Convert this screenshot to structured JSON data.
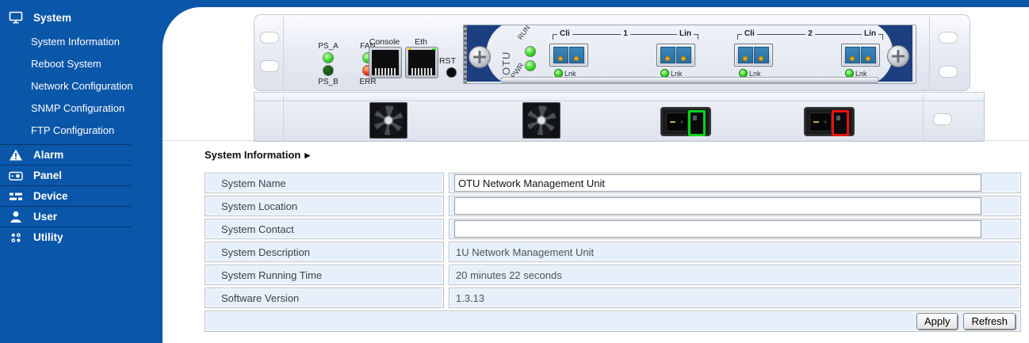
{
  "colors": {
    "sidebar_blue": "#0A56A8",
    "row_bg": "#E7F0FA",
    "power_ok_outline": "#00D41C",
    "power_err_outline": "#E81212",
    "led_green": "#2ED41E",
    "led_red": "#F02800"
  },
  "sidebar": {
    "sections": [
      {
        "label": "System",
        "icon": "monitor-icon"
      },
      {
        "label": "Alarm",
        "icon": "alarm-icon"
      },
      {
        "label": "Panel",
        "icon": "panel-icon"
      },
      {
        "label": "Device",
        "icon": "device-icon"
      },
      {
        "label": "User",
        "icon": "user-icon"
      },
      {
        "label": "Utility",
        "icon": "utility-icon"
      }
    ],
    "system_subitems": [
      "System Information",
      "Reboot System",
      "Network Configuration",
      "SNMP Configuration",
      "FTP Configuration"
    ]
  },
  "device": {
    "labels": {
      "ps_a": "PS_A",
      "fan": "FAN",
      "ps_b": "PS_B",
      "err": "ERR",
      "console": "Console",
      "eth": "Eth",
      "rst": "RST",
      "otu": "OTU",
      "run": "RUN",
      "pwr": "PWR",
      "lnk": "Lnk"
    },
    "groups": [
      {
        "cli": "Cli",
        "num": "1",
        "lin": "Lin"
      },
      {
        "cli": "Cli",
        "num": "2",
        "lin": "Lin"
      }
    ]
  },
  "main": {
    "heading": "System Information",
    "heading_arrow": "▶",
    "rows": [
      {
        "label": "System Name",
        "type": "input",
        "value": "OTU Network Management Unit"
      },
      {
        "label": "System Location",
        "type": "input",
        "value": ""
      },
      {
        "label": "System Contact",
        "type": "input",
        "value": ""
      },
      {
        "label": "System Description",
        "type": "text",
        "value": "1U Network Management Unit"
      },
      {
        "label": "System Running Time",
        "type": "text",
        "value": "20 minutes 22 seconds"
      },
      {
        "label": "Software Version",
        "type": "text",
        "value": "1.3.13"
      }
    ],
    "buttons": {
      "apply": "Apply",
      "refresh": "Refresh"
    }
  }
}
